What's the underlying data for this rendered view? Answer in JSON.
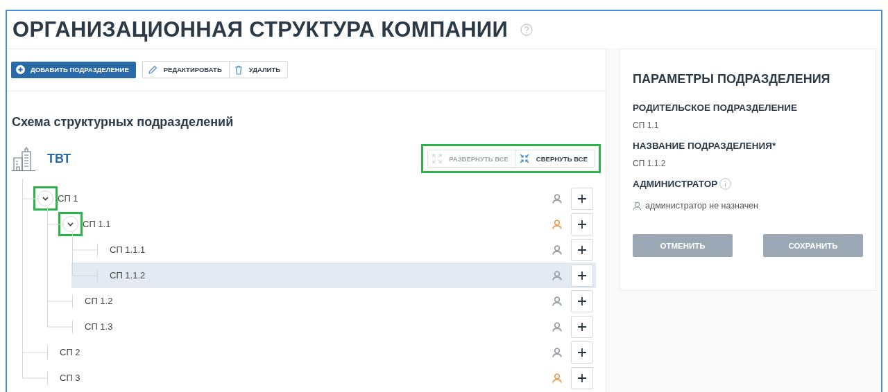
{
  "page": {
    "title": "ОРГАНИЗАЦИОННАЯ СТРУКТУРА КОМПАНИИ"
  },
  "toolbar": {
    "add_button": {
      "label": "ДОБАВИТЬ ПОДРАЗДЕЛЕНИЕ"
    },
    "buttons": [
      {
        "kind": "edit",
        "label": "РЕДАКТИРОВАТЬ"
      },
      {
        "kind": "delete",
        "label": "УДАЛИТЬ"
      }
    ]
  },
  "scheme": {
    "heading": "Схема структурных подразделений",
    "root": "ТВТ",
    "expand_controls": {
      "highlighted": true,
      "buttons": [
        {
          "kind": "expand",
          "label": "РАЗВЕРНУТЬ ВСЕ",
          "disabled": true
        },
        {
          "kind": "collapse",
          "label": "СВЕРНУТЬ ВСЕ",
          "disabled": false
        }
      ]
    },
    "tree": [
      {
        "label": "СП 1",
        "expanded": true,
        "highlighted": true,
        "selected": false,
        "color": "#9aa0a6",
        "children": [
          {
            "label": "СП 1.1",
            "expanded": true,
            "highlighted": true,
            "selected": false,
            "color": "#e8a25e",
            "children": [
              {
                "label": "СП 1.1.1",
                "selected": false,
                "color": "#9aa0a6"
              },
              {
                "label": "СП 1.1.2",
                "selected": true,
                "color": "#9aa0a6"
              }
            ]
          },
          {
            "label": "СП 1.2",
            "selected": false,
            "color": "#9aa0a6"
          },
          {
            "label": "СП 1.3",
            "selected": false,
            "color": "#9aa0a6"
          }
        ]
      },
      {
        "label": "СП 2",
        "selected": false,
        "color": "#9aa0a6"
      },
      {
        "label": "СП 3",
        "selected": false,
        "color": "#e8a25e"
      }
    ]
  },
  "details": {
    "heading": "ПАРАМЕТРЫ ПОДРАЗДЕЛЕНИЯ",
    "fields": [
      {
        "kind": "text",
        "label": "РОДИТЕЛЬСКОЕ ПОДРАЗДЕЛЕНИЕ",
        "value": "СП 1.1"
      },
      {
        "kind": "text",
        "label": "НАЗВАНИЕ ПОДРАЗДЕЛЕНИЯ*",
        "value": "СП 1.1.2"
      },
      {
        "kind": "admin",
        "label": "АДМИНИСТРАТОР",
        "value": "администратор не назначен"
      }
    ],
    "buttons": [
      {
        "label": "ОТМЕНИТЬ",
        "disabled": true
      },
      {
        "label": "СОХРАНИТЬ",
        "disabled": true
      }
    ]
  }
}
